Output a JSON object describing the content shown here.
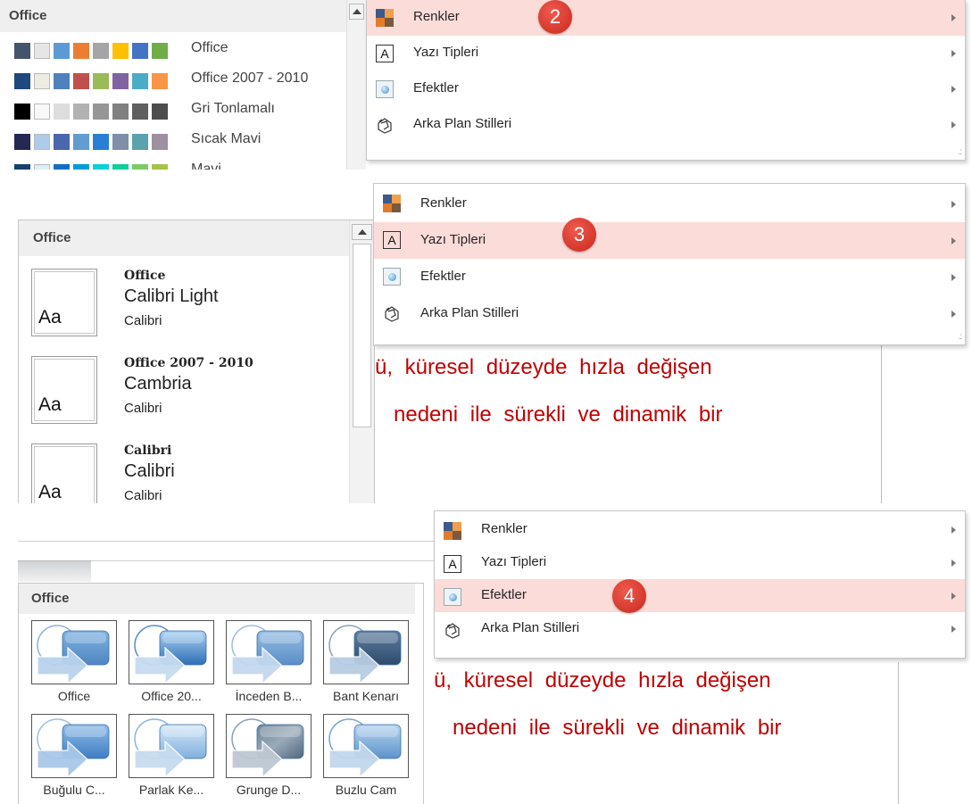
{
  "section1": {
    "gallery_header": "Office",
    "color_schemes": [
      {
        "label": "Office",
        "colors": [
          "#44546a",
          "#e7e6e6",
          "#5b9bd5",
          "#ed7d31",
          "#a5a5a5",
          "#ffc000",
          "#4472c4",
          "#70ad47"
        ]
      },
      {
        "label": "Office 2007 - 2010",
        "colors": [
          "#1f497d",
          "#eeece1",
          "#4f81bd",
          "#c0504d",
          "#9bbb59",
          "#8064a2",
          "#4bacc6",
          "#f79646"
        ]
      },
      {
        "label": "Gri Tonlamalı",
        "colors": [
          "#000000",
          "#f8f8f8",
          "#dddddd",
          "#b2b2b2",
          "#969696",
          "#808080",
          "#5f5f5f",
          "#4d4d4d"
        ]
      },
      {
        "label": "Sıcak Mavi",
        "colors": [
          "#242852",
          "#acccea",
          "#4a66ac",
          "#629dd1",
          "#297fd5",
          "#7f8fa9",
          "#5aa2ae",
          "#9d90a0"
        ]
      },
      {
        "label": "Mavi",
        "colors": [
          "#17406d",
          "#dbeff9",
          "#0f6fc6",
          "#009dd9",
          "#0bd0d9",
          "#10cf9b",
          "#7cca62",
          "#a5c249"
        ]
      }
    ],
    "badge": "2",
    "highlight_index": 0
  },
  "section2": {
    "gallery_header": "Office",
    "font_themes": [
      {
        "name": "Office",
        "heading": "Calibri Light",
        "body": "Calibri",
        "sample": "Aa"
      },
      {
        "name": "Office 2007 - 2010",
        "heading": "Cambria",
        "body": "Calibri",
        "sample": "Aa"
      },
      {
        "name": "Calibri",
        "heading": "Calibri",
        "body": "Calibri",
        "sample": "Aa"
      }
    ],
    "badge": "3",
    "highlight_index": 1,
    "slide_lines": [
      "ü,  küresel  düzeyde  hızla  değişen",
      "nedeni  ile  sürekli  ve  dinamik  bir"
    ]
  },
  "section3": {
    "gallery_header": "Office",
    "effects": [
      {
        "label": "Office",
        "style": "plain"
      },
      {
        "label": "Office 20...",
        "style": "glossy"
      },
      {
        "label": "İnceden B...",
        "style": "soft"
      },
      {
        "label": "Bant Kenarı",
        "style": "dark"
      },
      {
        "label": "Buğulu C...",
        "style": "glow"
      },
      {
        "label": "Parlak Ke...",
        "style": "bright"
      },
      {
        "label": "Grunge D...",
        "style": "grunge"
      },
      {
        "label": "Buzlu Cam",
        "style": "frosted"
      }
    ],
    "badge": "4",
    "highlight_index": 2,
    "slide_lines": [
      "ü,  küresel  düzeyde  hızla  değişen",
      "nedeni  ile  sürekli  ve  dinamik  bir"
    ]
  },
  "menu": {
    "items": [
      {
        "label": "Renkler",
        "icon": "colors-icon"
      },
      {
        "label": "Yazı Tipleri",
        "icon": "fonts-icon"
      },
      {
        "label": "Efektler",
        "icon": "effects-icon"
      },
      {
        "label": "Arka Plan Stilleri",
        "icon": "background-styles-icon"
      }
    ],
    "font_icon_glyph": "A",
    "grip": ".:"
  },
  "colors": {
    "highlight": "#fbdcd8",
    "badge": "#d9352a",
    "slide_text": "#c00000"
  }
}
